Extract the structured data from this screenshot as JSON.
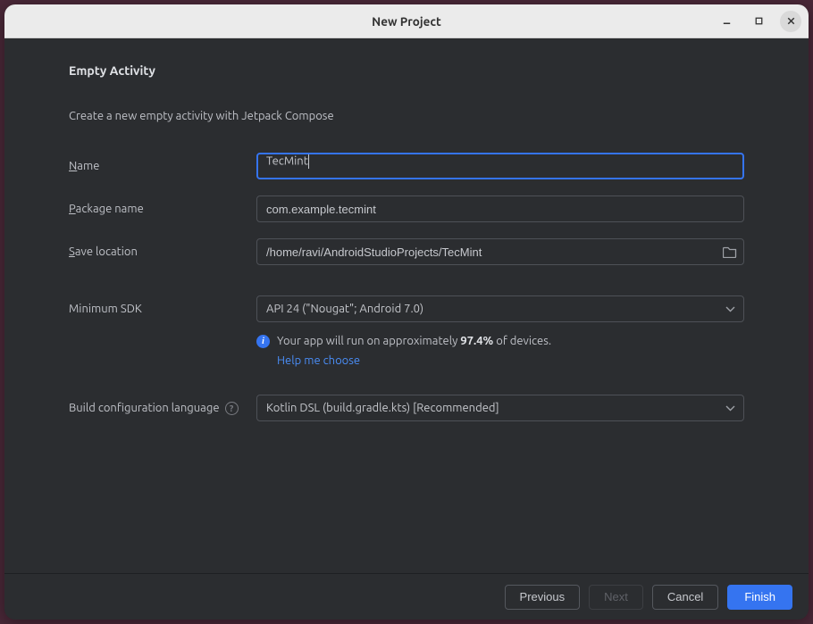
{
  "window": {
    "title": "New Project"
  },
  "page": {
    "heading": "Empty Activity",
    "subheading": "Create a new empty activity with Jetpack Compose"
  },
  "form": {
    "name": {
      "label": "Name",
      "value": "TecMint"
    },
    "package_name": {
      "label": "Package name",
      "value": "com.example.tecmint"
    },
    "save_location": {
      "label": "Save location",
      "value": "/home/ravi/AndroidStudioProjects/TecMint"
    },
    "minimum_sdk": {
      "label": "Minimum SDK",
      "value": "API 24 (\"Nougat\"; Android 7.0)"
    },
    "build_lang": {
      "label": "Build configuration language",
      "value": "Kotlin DSL (build.gradle.kts) [Recommended]"
    }
  },
  "hint": {
    "prefix": "Your app will run on approximately ",
    "percentage": "97.4%",
    "suffix": " of devices.",
    "link": "Help me choose"
  },
  "footer": {
    "previous": "Previous",
    "next": "Next",
    "cancel": "Cancel",
    "finish": "Finish"
  }
}
